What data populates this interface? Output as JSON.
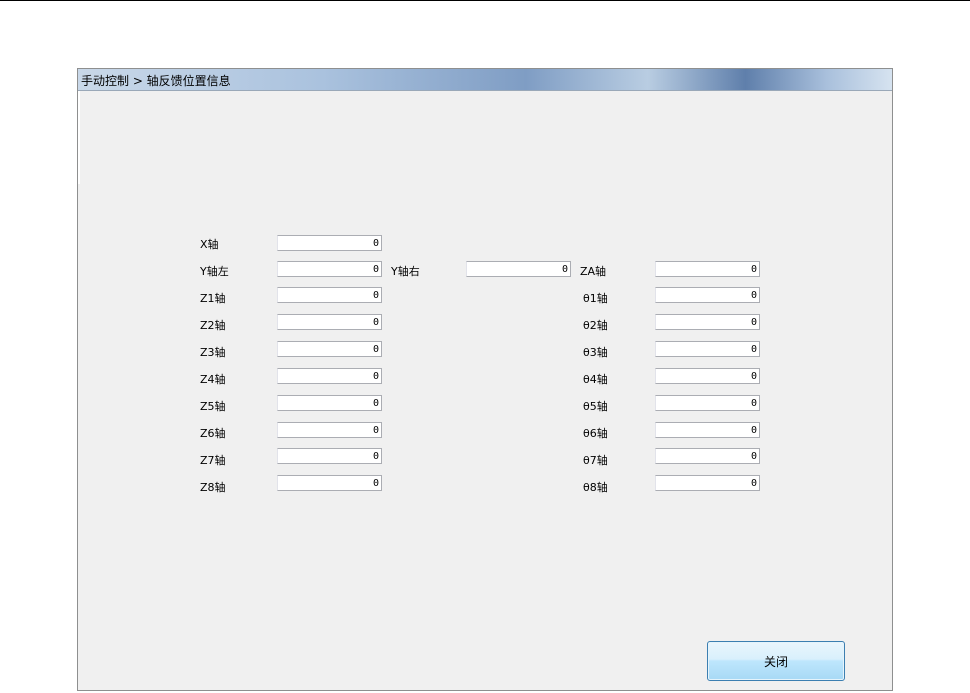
{
  "window": {
    "title": "手动控制 > 轴反馈位置信息",
    "close_button": "关闭"
  },
  "left_column": [
    {
      "label": "X轴",
      "value": "0"
    },
    {
      "label": "Y轴左",
      "value": "0"
    },
    {
      "label": "Z1轴",
      "value": "0"
    },
    {
      "label": "Z2轴",
      "value": "0"
    },
    {
      "label": "Z3轴",
      "value": "0"
    },
    {
      "label": "Z4轴",
      "value": "0"
    },
    {
      "label": "Z5轴",
      "value": "0"
    },
    {
      "label": "Z6轴",
      "value": "0"
    },
    {
      "label": "Z7轴",
      "value": "0"
    },
    {
      "label": "Z8轴",
      "value": "0"
    }
  ],
  "middle_column": [
    {
      "label": "Y轴右",
      "value": "0"
    }
  ],
  "right_column": [
    {
      "label": "ZA轴",
      "value": "0"
    },
    {
      "label": "θ1轴",
      "value": "0"
    },
    {
      "label": "θ2轴",
      "value": "0"
    },
    {
      "label": "θ3轴",
      "value": "0"
    },
    {
      "label": "θ4轴",
      "value": "0"
    },
    {
      "label": "θ5轴",
      "value": "0"
    },
    {
      "label": "θ6轴",
      "value": "0"
    },
    {
      "label": "θ7轴",
      "value": "0"
    },
    {
      "label": "θ8轴",
      "value": "0"
    }
  ]
}
